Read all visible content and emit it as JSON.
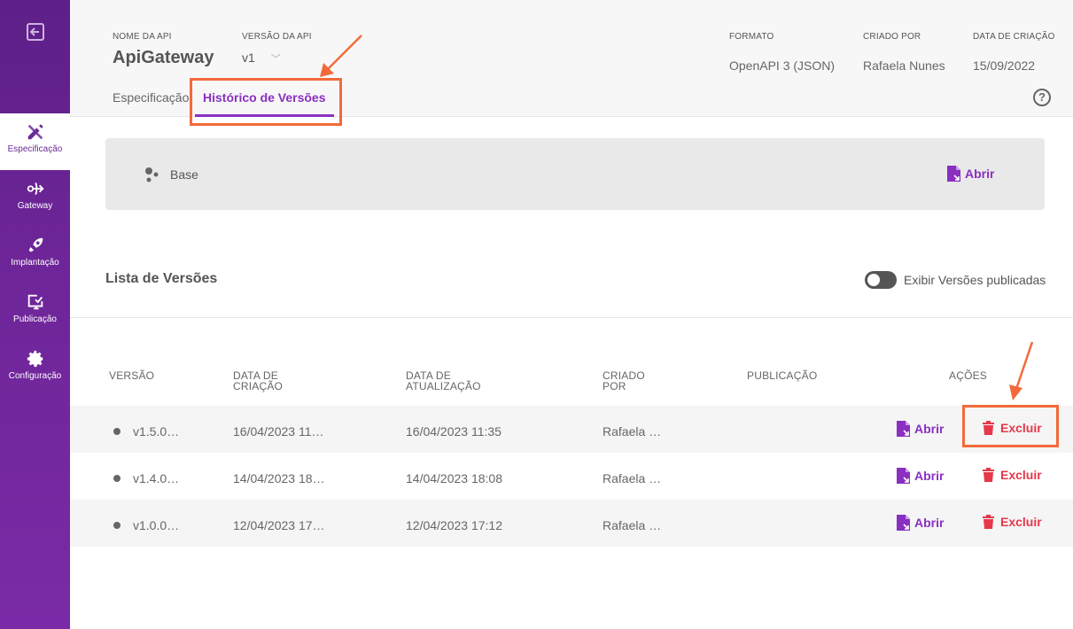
{
  "sidebar": {
    "items": [
      {
        "label": "Especificação",
        "icon": "pencil-ruler-icon",
        "active": true
      },
      {
        "label": "Gateway",
        "icon": "gateway-icon"
      },
      {
        "label": "Implantação",
        "icon": "rocket-icon"
      },
      {
        "label": "Publicação",
        "icon": "publish-icon"
      },
      {
        "label": "Configuração",
        "icon": "gear-icon"
      }
    ]
  },
  "header": {
    "api_name_label": "NOME DA API",
    "api_name": "ApiGateway",
    "version_label": "VERSÃO DA API",
    "version": "v1",
    "format_label": "FORMATO",
    "format": "OpenAPI 3 (JSON)",
    "created_by_label": "CRIADO POR",
    "created_by": "Rafaela Nunes",
    "created_date_label": "DATA DE CRIAÇÃO",
    "created_date": "15/09/2022",
    "tabs": [
      {
        "label": "Especificação"
      },
      {
        "label": "Histórico de Versões",
        "active": true
      }
    ]
  },
  "base": {
    "label": "Base",
    "open_label": "Abrir"
  },
  "versions": {
    "title": "Lista de Versões",
    "toggle_label": "Exibir Versões publicadas",
    "columns": {
      "version": "VERSÃO",
      "created_1": "DATA DE",
      "created_2": "CRIAÇÃO",
      "updated_1": "DATA DE",
      "updated_2": "ATUALIZAÇÃO",
      "by_1": "CRIADO",
      "by_2": "POR",
      "publication": "PUBLICAÇÃO",
      "actions": "AÇÕES"
    },
    "rows": [
      {
        "version": "v1.5.0…",
        "created": "16/04/2023 11…",
        "updated": "16/04/2023 11:35",
        "by": "Rafaela …",
        "publication": "",
        "open": "Abrir",
        "delete": "Excluir"
      },
      {
        "version": "v1.4.0…",
        "created": "14/04/2023 18…",
        "updated": "14/04/2023 18:08",
        "by": "Rafaela …",
        "publication": "",
        "open": "Abrir",
        "delete": "Excluir"
      },
      {
        "version": "v1.0.0…",
        "created": "12/04/2023 17…",
        "updated": "12/04/2023 17:12",
        "by": "Rafaela …",
        "publication": "",
        "open": "Abrir",
        "delete": "Excluir"
      }
    ]
  },
  "colors": {
    "sidebar": "#6d2598",
    "accent": "#8a2fc0",
    "danger": "#e5384a",
    "annotation": "#f26a3a"
  }
}
